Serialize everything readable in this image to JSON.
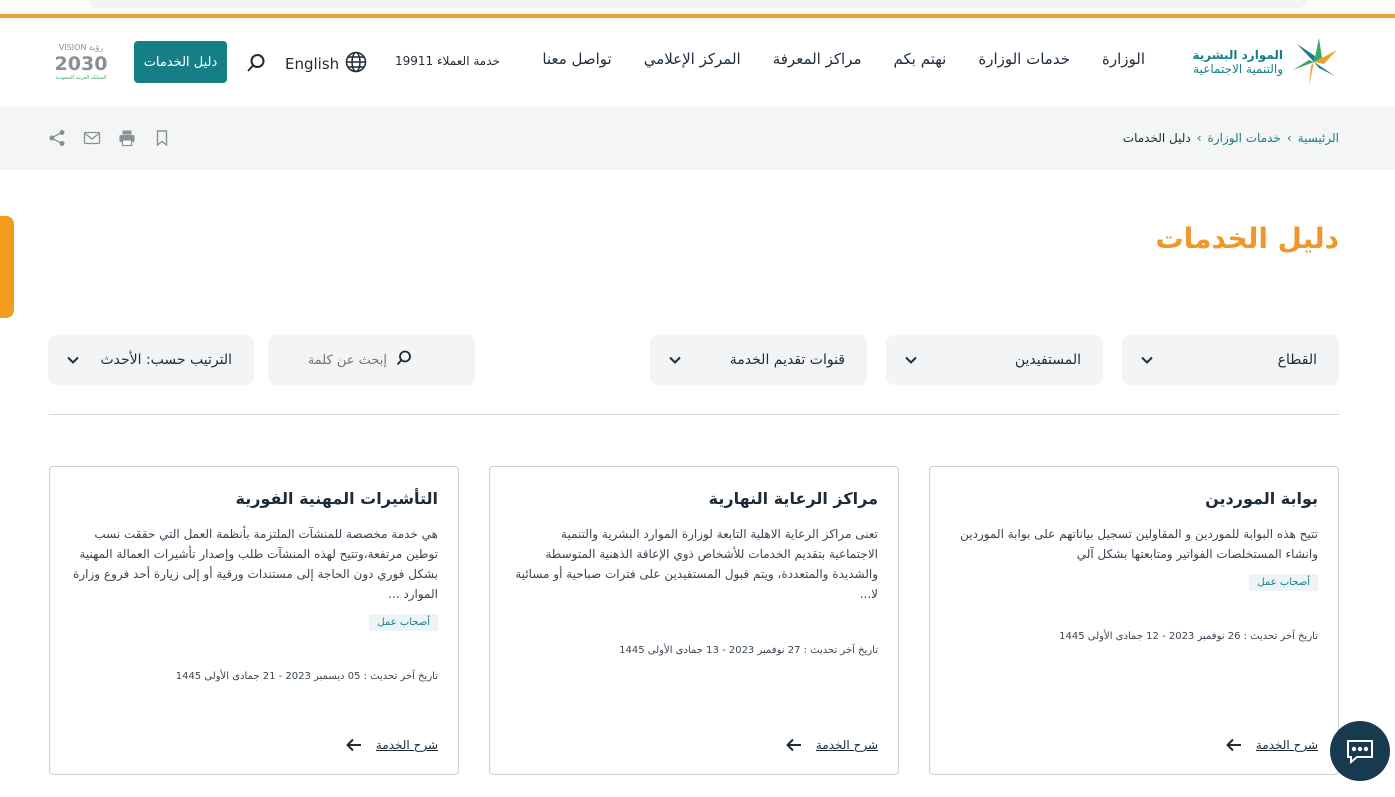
{
  "header": {
    "logo_line1": "الموارد البشرية",
    "logo_line2": "والتنمية الاجتماعية",
    "nav": [
      "الوزارة",
      "خدمات الوزارة",
      "نهتم بكم",
      "مراكز المعرفة",
      "المركز الإعلامي",
      "تواصل معنا"
    ],
    "customer_care": "خدمة العملاء 19911",
    "language": "English",
    "guide_button": "دليل الخدمات",
    "vision_top": "VISION رؤية",
    "vision_year": "2030",
    "vision_sub": "المملكة العربية السعودية"
  },
  "breadcrumb": {
    "items": [
      "الرئيسية",
      "خدمات الوزارة"
    ],
    "current": "دليل الخدمات",
    "separator": "›"
  },
  "page": {
    "title": "دليل الخدمات"
  },
  "filters": {
    "sector": "القطاع",
    "beneficiaries": "المستفيدين",
    "channels": "قنوات تقديم الخدمة",
    "search_placeholder": "إبحث عن كلمة",
    "sort": "الترتيب حسب: الأحدث"
  },
  "cards": [
    {
      "title": "بوابة الموردين",
      "description": "تتيح هذه البوابة للموردين و المقاولين تسجيل بياناتهم على بوابة الموردين وانشاء المستخلصات الفواتير ومتابعتها بشكل آلي",
      "badge": "أصحاب عمل",
      "updated": "تاريخ آخر تحديث : 26 نوفمبر 2023 - 12 جمادى الأولى 1445",
      "more": "شرح الخدمة"
    },
    {
      "title": "مراكز الرعاية النهارية",
      "description": "تعنى مراكز الرعاية الاهلية التابعة لوزارة الموارد البشرية والتنمية الاجتماعية بتقديم الخدمات للأشخاص ذوي الإعاقة الذهنية المتوسطة والشديدة والمتعددة، ويتم قبول المستفيدين على فترات صباحية أو مسائية لا...",
      "badge": "",
      "updated": "تاريخ آخر تحديث : 27 نوفمبر 2023 - 13 جمادى الأولى 1445",
      "more": "شرح الخدمة"
    },
    {
      "title": "التأشيرات المهنية الفورية",
      "description": "هي خدمة مخصصة للمنشآت الملتزمة بأنظمة العمل التي حققت نسب توطين مرتفعة،وتتيح لهذه المنشآت طلب وإصدار تأشيرات العمالة المهنية بشكل فوري دون الحاجة إلى مستندات ورقية أو إلى زيارة أحد فروع وزارة الموارد ...",
      "badge": "أصحاب عمل",
      "updated": "تاريخ آخر تحديث : 05 ديسمبر 2023 - 21 جمادى الأولى 1445",
      "more": "شرح الخدمة"
    }
  ],
  "colors": {
    "brand_teal": "#167f86",
    "accent_orange": "#f0962b",
    "chat_navy": "#173a4e"
  },
  "icons": [
    "globe-icon",
    "search-icon",
    "share-icon",
    "mail-icon",
    "print-icon",
    "bookmark-icon",
    "chevron-down-icon",
    "arrow-left-icon",
    "chat-icon"
  ]
}
